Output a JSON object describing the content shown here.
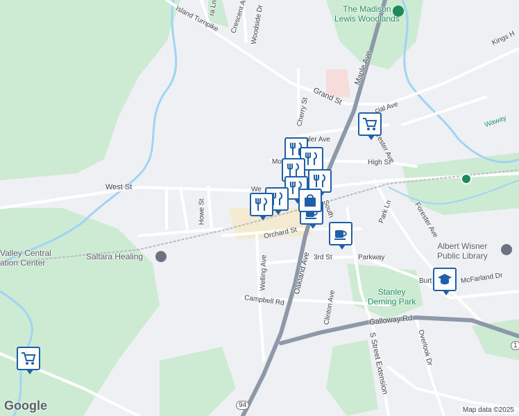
{
  "map": {
    "labels": {
      "madison_woodlands": "The Madison\nLewis Woodlands",
      "island_turnpike": "Island Turnpike",
      "crescent_ave": "Crescent Ave",
      "woodside_dr": "Woodside Dr",
      "ra_ln": "ra Ln",
      "kings_hwy": "Kings H",
      "grand_st": "Grand St",
      "maple_ave": "Maple Ave",
      "cherry_st": "Cherry St",
      "cial_ave": "cial Ave",
      "nler_ave": "nler Ave",
      "mo": "Mo",
      "high_st": "High St",
      "west_st": "West St",
      "we": "We",
      "howe_st": "Howe St",
      "south": "South",
      "orchard_st": "Orchard St",
      "park_ln": "Park Ln",
      "forester_ave_upper": "Forester Ave",
      "forester_ave_lower": "Forester Ave",
      "albert_wisner": "Albert Wisner\nPublic Library",
      "valley_central": "Valley Central\nation Center",
      "saltara_healing": "Saltara Healing",
      "welling_ave": "Welling Ave",
      "oakland_ave": "Oakland Ave",
      "third_st": "3rd St",
      "parkway": "Parkway",
      "burt": "Burt",
      "mcfarland_dr": "McFarland Dr",
      "stanley_deming": "Stanley\nDeming Park",
      "campbell_rd": "Campbell Rd",
      "clinton_ave": "Clinton Ave",
      "galloway_rd": "Galloway Rd",
      "overlook_dr": "Overlook Dr",
      "s_street_ext": "S Street Extension",
      "route_94": "94",
      "route_1": "1",
      "waway": "Waway"
    },
    "markers": [
      {
        "type": "grocery",
        "name": "grocery-marker-top"
      },
      {
        "type": "grocery",
        "name": "grocery-marker-left"
      },
      {
        "type": "coffee",
        "name": "coffee-marker-center"
      },
      {
        "type": "coffee",
        "name": "coffee-marker-right"
      },
      {
        "type": "school",
        "name": "school-marker"
      },
      {
        "type": "restaurant",
        "name": "restaurant-cluster"
      },
      {
        "type": "shopping",
        "name": "shopping-marker"
      }
    ],
    "colors": {
      "background": "#eef0f3",
      "park": "#cdebd3",
      "water": "#9fd4f5",
      "highway": "#8d99a9",
      "road": "#ffffff",
      "marker_border": "#1f5fa8"
    },
    "attribution": "Map data ©2025",
    "logo": "Google"
  }
}
